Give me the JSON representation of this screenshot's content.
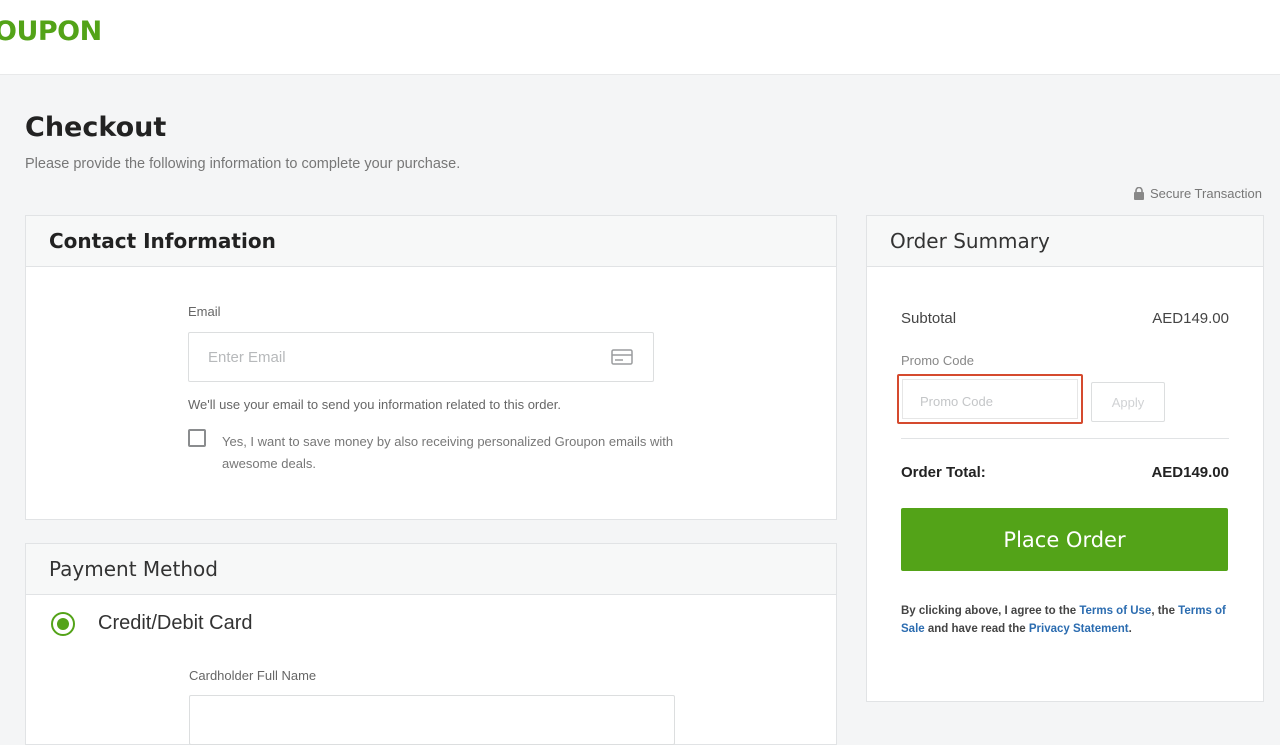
{
  "brand": {
    "logo_text": "OUPON",
    "brand_color": "#53a318"
  },
  "page": {
    "title": "Checkout",
    "subtitle": "Please provide the following information to complete your purchase.",
    "secure_label": "Secure Transaction"
  },
  "contact": {
    "heading": "Contact Information",
    "email_label": "Email",
    "email_placeholder": "Enter Email",
    "email_value": "",
    "email_note": "We'll use your email to send you information related to this order.",
    "optin_checked": false,
    "optin_label": "Yes, I want to save money by also receiving personalized Groupon emails with awesome deals."
  },
  "payment": {
    "heading": "Payment Method",
    "option_label": "Credit/Debit Card",
    "option_selected": true,
    "holder_label": "Cardholder Full Name",
    "holder_value": ""
  },
  "summary": {
    "heading": "Order Summary",
    "subtotal_label": "Subtotal",
    "subtotal_value": "AED149.00",
    "promo_label": "Promo Code",
    "promo_placeholder": "Promo Code",
    "promo_value": "",
    "apply_label": "Apply",
    "total_label": "Order Total:",
    "total_value": "AED149.00",
    "place_order_label": "Place Order",
    "legal_prefix": "By clicking above, I agree to the ",
    "terms_of_use": "Terms of Use",
    "legal_mid1": ", the ",
    "terms_of_sale": "Terms of Sale",
    "legal_mid2": " and have read the ",
    "privacy_statement": "Privacy Statement",
    "legal_suffix": "."
  },
  "colors": {
    "accent": "#53a318",
    "promo_highlight": "#d54a2e",
    "link": "#2b6cb0"
  },
  "icons": [
    "lock-icon",
    "email-card-icon",
    "radio-selected-icon",
    "checkbox-icon"
  ]
}
